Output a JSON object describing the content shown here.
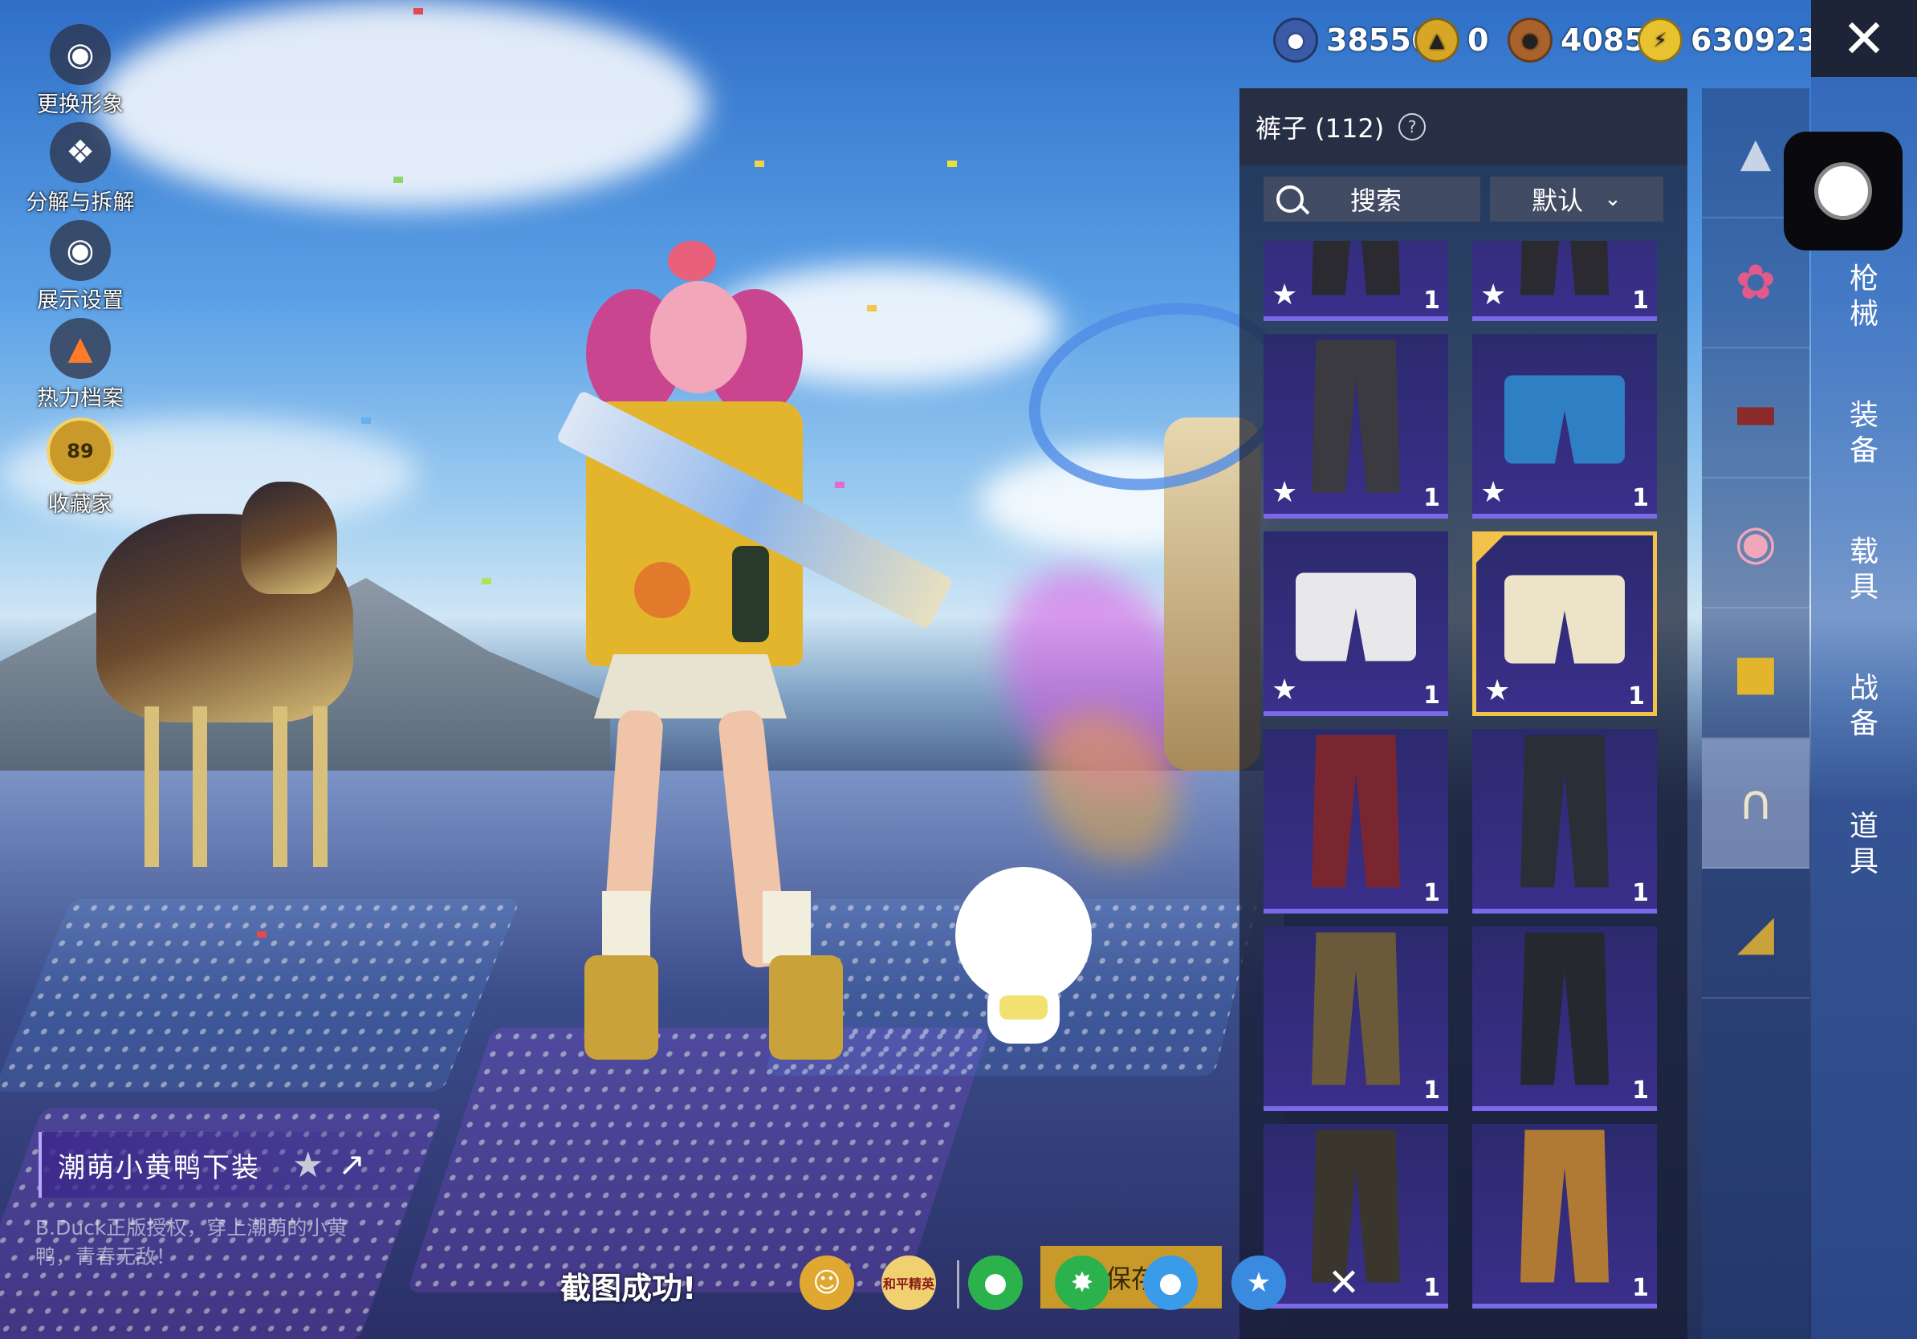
{
  "left_menu": [
    {
      "label": "更换形象",
      "icon": "avatar-icon"
    },
    {
      "label": "分解与拆解",
      "icon": "puzzle-icon"
    },
    {
      "label": "展示设置",
      "icon": "eye-icon"
    },
    {
      "label": "热力档案",
      "icon": "flame-icon"
    },
    {
      "label": "收藏家",
      "icon": "collector-badge-icon",
      "badge": "89"
    }
  ],
  "currencies": [
    {
      "value": "38556",
      "icon": "silver-coin-icon",
      "color": "#3b5ba8"
    },
    {
      "value": "0",
      "icon": "gold-token-icon",
      "color": "#d8a626"
    },
    {
      "value": "4085",
      "icon": "bronze-coin-icon",
      "color": "#a8622c"
    },
    {
      "value": "630923",
      "icon": "bp-coin-icon",
      "color": "#e9c230"
    }
  ],
  "close_label": "✕",
  "panel": {
    "title": "裤子 (112)",
    "search_placeholder": "搜索",
    "sort_label": "默认",
    "items": [
      {
        "count": "1",
        "star": true,
        "color": "#2a2a30",
        "kind": "pants"
      },
      {
        "count": "1",
        "star": true,
        "color": "#2a2a30",
        "kind": "pants"
      },
      {
        "count": "1",
        "star": true,
        "color": "#3a3a40",
        "kind": "pants"
      },
      {
        "count": "1",
        "star": true,
        "color": "#2f7fc4",
        "kind": "shorts"
      },
      {
        "count": "1",
        "star": true,
        "color": "#e8e8ea",
        "kind": "shorts"
      },
      {
        "count": "1",
        "star": true,
        "color": "#ece3c8",
        "kind": "shorts",
        "selected": true
      },
      {
        "count": "1",
        "star": false,
        "color": "#7a2630",
        "kind": "pants"
      },
      {
        "count": "1",
        "star": false,
        "color": "#2a2e36",
        "kind": "pants"
      },
      {
        "count": "1",
        "star": false,
        "color": "#6a5a3a",
        "kind": "pants"
      },
      {
        "count": "1",
        "star": false,
        "color": "#262830",
        "kind": "pants"
      },
      {
        "count": "1",
        "star": false,
        "color": "#3a362e",
        "kind": "pants"
      },
      {
        "count": "1",
        "star": false,
        "color": "#b07a34",
        "kind": "pants"
      }
    ]
  },
  "categories": [
    {
      "icon": "hat-icon"
    },
    {
      "icon": "bow-icon"
    },
    {
      "icon": "mask-icon"
    },
    {
      "icon": "jacket-icon"
    },
    {
      "icon": "pants-icon",
      "active": true
    },
    {
      "icon": "shoes-icon"
    }
  ],
  "tabs": [
    {
      "label": "枪械"
    },
    {
      "label": "装备"
    },
    {
      "label": "载具"
    },
    {
      "label": "战备"
    },
    {
      "label": "道具"
    }
  ],
  "item_name": "潮萌小黄鸭下装",
  "item_desc": "B.Duck正版授权，穿上潮萌的小黄鸭，青春无敌！",
  "screenshot_text": "截图成功!",
  "share": [
    {
      "icon": "profile-share-icon",
      "color": "#e0a830"
    },
    {
      "icon": "game-logo-icon",
      "color": "#f0d070",
      "label": "和平精英"
    },
    {
      "icon": "wechat-icon",
      "color": "#2bb24c"
    },
    {
      "icon": "moments-icon",
      "color": "#2bb24c"
    },
    {
      "icon": "qq-icon",
      "color": "#3a9be8"
    },
    {
      "icon": "qzone-icon",
      "color": "#3a8ae0"
    }
  ],
  "save_label": "保存"
}
